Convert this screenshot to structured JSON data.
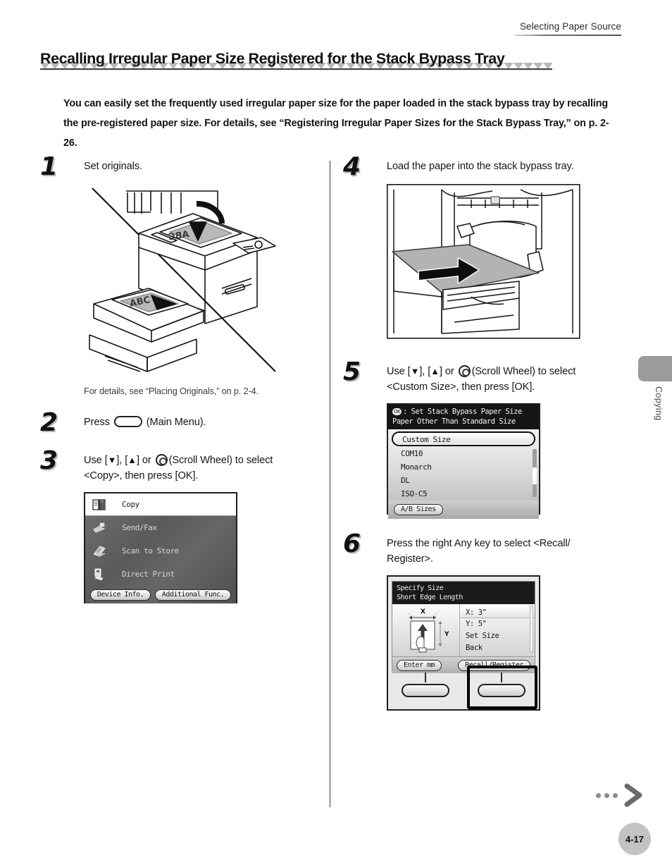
{
  "header": {
    "running_head": "Selecting Paper Source"
  },
  "title": {
    "text": "Recalling Irregular Paper Size Registered for the Stack Bypass Tray"
  },
  "intro": {
    "text": "You can easily set the frequently used irregular paper size for the paper loaded in the stack bypass tray by recalling the pre-registered paper size. For details, see “Registering Irregular Paper Sizes for the Stack Bypass Tray,” on p. 2-26."
  },
  "steps": {
    "step1": {
      "number": "1",
      "text": "Set originals.",
      "caption": "For details, see “Placing Originals,” on p. 2-4.",
      "illustration_labels": {
        "platen": "ABC",
        "feeder": "ABC"
      }
    },
    "step2": {
      "number": "2",
      "text_before": "Press",
      "text_after": "(Main Menu)."
    },
    "step3": {
      "number": "3",
      "line1_before": "Use [",
      "down": "▼",
      "line1_mid": "], [",
      "up": "▲",
      "line1_after": "] or",
      "line1_tail": "(Scroll Wheel) to select",
      "line2": "<Copy>, then press [OK]."
    },
    "step4": {
      "number": "4",
      "text": "Load the paper into the stack bypass tray."
    },
    "step5": {
      "number": "5",
      "line1_before": "Use [",
      "down": "▼",
      "line1_mid": "], [",
      "up": "▲",
      "line1_after": "] or",
      "line1_tail": "(Scroll Wheel) to select",
      "line2": "<Custom Size>, then press [OK]."
    },
    "step6": {
      "number": "6",
      "line1": "Press the right Any key to select <Recall/",
      "line2": "Register>."
    }
  },
  "main_menu_lcd": {
    "selected_label": "Copy",
    "items": [
      {
        "label": "Send/Fax",
        "icon": "send-fax-icon"
      },
      {
        "label": "Scan to Store",
        "icon": "scan-to-store-icon"
      },
      {
        "label": "Direct Print",
        "icon": "direct-print-icon"
      }
    ],
    "buttons": [
      {
        "label": "Device Info."
      },
      {
        "label": "Additional Func."
      }
    ]
  },
  "paper_size_lcd": {
    "ok_badge": "OK",
    "head_line1": ": Set Stack Bypass Paper Size",
    "head_line2": "Paper Other Than Standard Size",
    "items": [
      {
        "label": "Custom Size",
        "selected": true
      },
      {
        "label": "COM10",
        "selected": false
      },
      {
        "label": "Monarch",
        "selected": false
      },
      {
        "label": "DL",
        "selected": false
      },
      {
        "label": "ISO-C5",
        "selected": false
      }
    ],
    "footer_button": "A/B Sizes"
  },
  "specify_size_lcd": {
    "head_line1": "Specify Size",
    "head_line2": "Short Edge Length",
    "diagram": {
      "x_label": "X",
      "y_label": "Y"
    },
    "items": [
      {
        "label": "X: 3\"",
        "selected": true
      },
      {
        "label": "Y: 5\"",
        "selected": false
      },
      {
        "label": "Set Size",
        "selected": false
      },
      {
        "label": "Back",
        "selected": false
      }
    ],
    "buttons": [
      {
        "label": "Enter mm",
        "highlighted": false
      },
      {
        "label": "Recall/Register",
        "highlighted": true
      }
    ]
  },
  "side_tab": {
    "label": "Copying"
  },
  "footer": {
    "page_number": "4-17"
  },
  "colors": {
    "accent_gray": "#9b9b9b",
    "rule_dark": "#3a3a3a",
    "lcd_dark": "#151515"
  }
}
